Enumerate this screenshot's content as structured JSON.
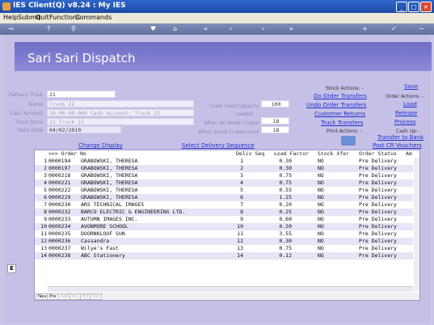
{
  "window": {
    "title": "IES Client(Q) v8.24 : My IES",
    "minimize": "_",
    "maximize": "□",
    "close": "×"
  },
  "menu": [
    "Help",
    "Submit",
    "Quit",
    "Functions",
    "Commands"
  ],
  "page_title": "Sari Sari Dispatch",
  "form": {
    "delivery_truck": {
      "label": "Delivery Truck",
      "value": "21"
    },
    "name": {
      "label": "Name",
      "value": "Truck 21"
    },
    "cash_account": {
      "label": "Cash Account",
      "value": "10-00-00-060 Cash Account: Truck 21"
    },
    "truck_store": {
      "label": "Truck Store",
      "value": "21 Truck 21"
    },
    "deliv_date": {
      "label": "Deliv Date",
      "value": "04/02/2010"
    },
    "crate_load_capacity": {
      "label": "Crate Load Capacity",
      "value": "100"
    },
    "loaded": {
      "label": "Loaded",
      "value": "-"
    },
    "when_no_break_crates": {
      "label": "When No Break Crates",
      "value": "18"
    },
    "when_break_crates_used": {
      "label": "When Break Crates Used",
      "value": "18"
    }
  },
  "stock_actions": {
    "header": "Stock Actions: -",
    "items": [
      "Do Order Transfers",
      "Undo Order Transfers",
      "Customer Returns",
      "Truck Transfers"
    ]
  },
  "order_actions": {
    "save": "Save",
    "header": "Order Actions: -",
    "items": [
      "Load",
      "Release",
      "Process"
    ]
  },
  "print_actions": {
    "header": "Print Actions: -"
  },
  "cash_actions": {
    "header": "Cash Up: -",
    "items": [
      "Transfer to Bank",
      "Post CR Vouchers"
    ]
  },
  "grid_links": {
    "change_display": "Change Display",
    "select_delivery_sequence": "Select Delivery Sequence"
  },
  "grid": {
    "columns": [
      ">>> Order No",
      "Deliv Seq",
      "Load Factor",
      "Stock Xfer",
      "Order Status",
      "Am"
    ],
    "rows": [
      {
        "n": "1",
        "order_no": "0000194",
        "customer": "GRABOWSKI, THERESA",
        "seq": "1",
        "load": "0.30",
        "xfer": "NO",
        "status": "Pre Delivery"
      },
      {
        "n": "2",
        "order_no": "0000197",
        "customer": "GRABOWSKI, THERESA",
        "seq": "2",
        "load": "0.30",
        "xfer": "NO",
        "status": "Pre Delivery"
      },
      {
        "n": "3",
        "order_no": "0000218",
        "customer": "GRABOWSKI, THERESA",
        "seq": "3",
        "load": "0.75",
        "xfer": "NO",
        "status": "Pre Delivery"
      },
      {
        "n": "4",
        "order_no": "0000221",
        "customer": "GRABOWSKI, THERESA",
        "seq": "4",
        "load": "0.75",
        "xfer": "NO",
        "status": "Pre Delivery"
      },
      {
        "n": "5",
        "order_no": "0000222",
        "customer": "GRABOWSKI, THERESA",
        "seq": "5",
        "load": "0.55",
        "xfer": "NO",
        "status": "Pre Delivery"
      },
      {
        "n": "6",
        "order_no": "0000229",
        "customer": "GRABOWSKI, THERESA",
        "seq": "6",
        "load": "1.25",
        "xfer": "NO",
        "status": "Pre Delivery"
      },
      {
        "n": "7",
        "order_no": "0000230",
        "customer": "ARS TECHNICAL IMAGES",
        "seq": "7",
        "load": "0.20",
        "xfer": "NO",
        "status": "Pre Delivery"
      },
      {
        "n": "8",
        "order_no": "0000232",
        "customer": "BARCO ELECTRIC & ENGINEERING LTD.",
        "seq": "8",
        "load": "0.25",
        "xfer": "NO",
        "status": "Pre Delivery"
      },
      {
        "n": "9",
        "order_no": "0000233",
        "customer": "AUTUMN IMAGES INC.",
        "seq": "9",
        "load": "0.60",
        "xfer": "NO",
        "status": "Pre Delivery"
      },
      {
        "n": "10",
        "order_no": "0000234",
        "customer": "AVONMORE SCHOOL",
        "seq": "10",
        "load": "0.30",
        "xfer": "NO",
        "status": "Pre Delivery"
      },
      {
        "n": "11",
        "order_no": "0000235",
        "customer": "DOORNKLOOF SUN",
        "seq": "11",
        "load": "3.55",
        "xfer": "NO",
        "status": "Pre Delivery"
      },
      {
        "n": "12",
        "order_no": "0000236",
        "customer": "Cassandra",
        "seq": "12",
        "load": "0.30",
        "xfer": "NO",
        "status": "Pre Delivery"
      },
      {
        "n": "13",
        "order_no": "0000237",
        "customer": "Wilye's Fast",
        "seq": "13",
        "load": "0.75",
        "xfer": "NO",
        "status": "Pre Delivery"
      },
      {
        "n": "14",
        "order_no": "0000238",
        "customer": "ABC Stationery",
        "seq": "14",
        "load": "0.12",
        "xfer": "NO",
        "status": "Pre Delivery"
      }
    ],
    "tabs": [
      "Nev",
      "Pre",
      "Add",
      "Ins",
      "Ed",
      "Del"
    ]
  },
  "colors": {
    "header_bg": "#7b78cf",
    "panel_bg": "#c5c1e6",
    "link": "#1f2fd0",
    "alt_row": "#e6e4f6"
  }
}
